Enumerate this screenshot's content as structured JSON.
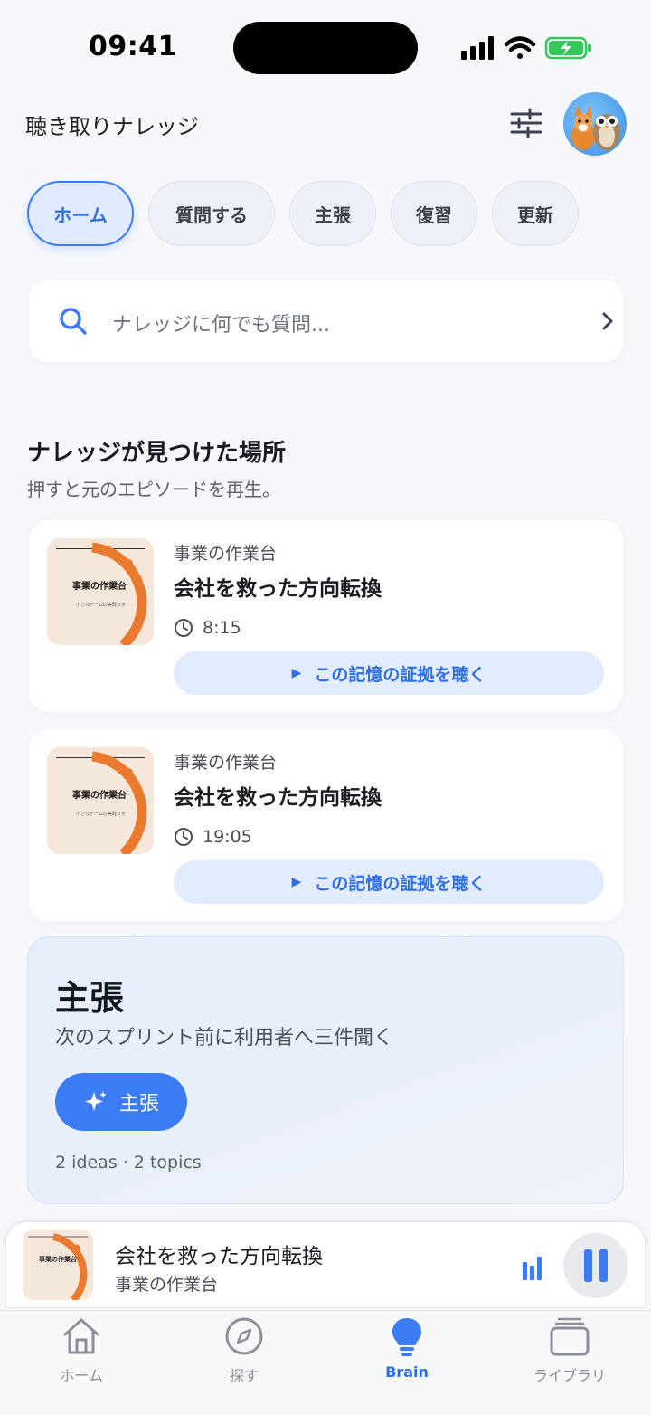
{
  "status": {
    "time": "09:41"
  },
  "header": {
    "title": "聴き取りナレッジ"
  },
  "chips": [
    {
      "label": "ホーム",
      "active": true
    },
    {
      "label": "質問する",
      "active": false
    },
    {
      "label": "主張",
      "active": false
    },
    {
      "label": "復習",
      "active": false
    },
    {
      "label": "更新",
      "active": false
    }
  ],
  "search": {
    "placeholder": "ナレッジに何でも質問..."
  },
  "section": {
    "title": "ナレッジが見つけた場所",
    "subtitle": "押すと元のエピソードを再生。"
  },
  "thumb": {
    "title": "事業の作業台",
    "subtitle": "小さなチームの実践ラボ"
  },
  "results": [
    {
      "show": "事業の作業台",
      "title": "会社を救った方向転換",
      "duration": "8:15",
      "action": "この記憶の証拠を聴く"
    },
    {
      "show": "事業の作業台",
      "title": "会社を救った方向転換",
      "duration": "19:05",
      "action": "この記憶の証拠を聴く"
    }
  ],
  "stance": {
    "title": "主張",
    "text": "次のスプリント前に利用者へ三件聞く",
    "button": "主張",
    "meta": "2 ideas · 2 topics"
  },
  "player": {
    "title": "会社を救った方向転換",
    "show": "事業の作業台"
  },
  "tabs": [
    {
      "label": "ホーム",
      "icon": "home-icon",
      "active": false
    },
    {
      "label": "探す",
      "icon": "compass-icon",
      "active": false
    },
    {
      "label": "Brain",
      "icon": "lightbulb-icon",
      "active": true
    },
    {
      "label": "ライブラリ",
      "icon": "library-icon",
      "active": false
    }
  ],
  "colors": {
    "accent": "#3b7bf3",
    "thumb_arc": "#ea7a2e",
    "thumb_bg": "#f5e7da"
  }
}
